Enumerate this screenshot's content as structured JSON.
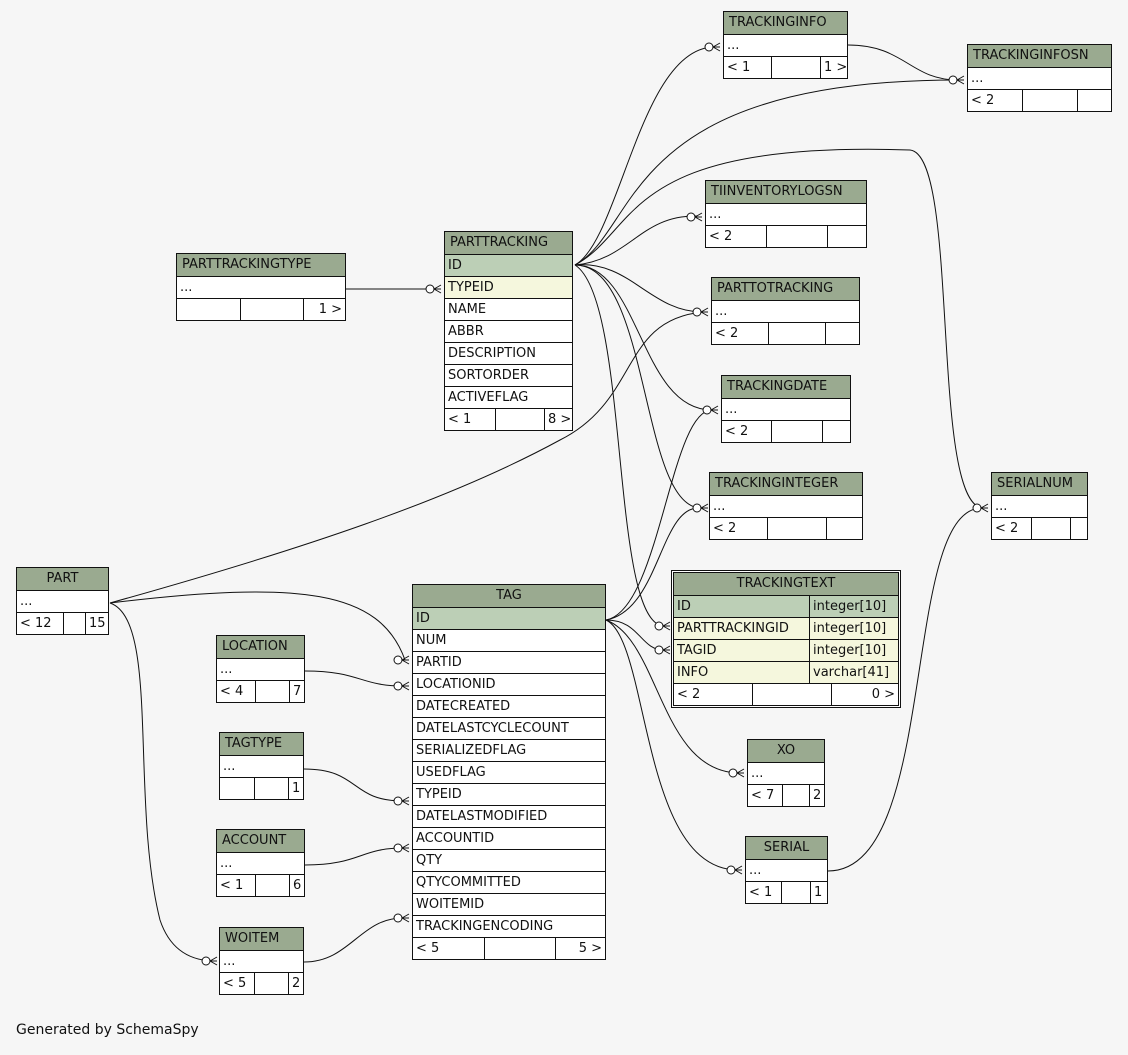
{
  "footer": "Generated by SchemaSpy",
  "tables": {
    "trackinginfo": {
      "name": "TRACKINGINFO",
      "rows": [
        "..."
      ],
      "footer": [
        "< 1",
        "",
        "1 >"
      ]
    },
    "trackinginfosn": {
      "name": "TRACKINGINFOSN",
      "rows": [
        "..."
      ],
      "footer": [
        "< 2",
        "",
        ""
      ]
    },
    "tiinventorylogsn": {
      "name": "TIINVENTORYLOGSN",
      "rows": [
        "..."
      ],
      "footer": [
        "< 2",
        "",
        ""
      ]
    },
    "parttotracking": {
      "name": "PARTTOTRACKING",
      "rows": [
        "..."
      ],
      "footer": [
        "< 2",
        "",
        ""
      ]
    },
    "trackingdate": {
      "name": "TRACKINGDATE",
      "rows": [
        "..."
      ],
      "footer": [
        "< 2",
        "",
        ""
      ]
    },
    "trackinginteger": {
      "name": "TRACKINGINTEGER",
      "rows": [
        "..."
      ],
      "footer": [
        "< 2",
        "",
        ""
      ]
    },
    "serialnum": {
      "name": "SERIALNUM",
      "rows": [
        "..."
      ],
      "footer": [
        "< 2",
        "",
        ""
      ]
    },
    "parttrackingtype": {
      "name": "PARTTRACKINGTYPE",
      "rows": [
        "..."
      ],
      "footer": [
        "",
        "",
        "1 >"
      ]
    },
    "parttracking": {
      "name": "PARTTRACKING",
      "rows": [
        "ID",
        "TYPEID",
        "NAME",
        "ABBR",
        "DESCRIPTION",
        "SORTORDER",
        "ACTIVEFLAG"
      ],
      "footer": [
        "< 1",
        "",
        "8 >"
      ]
    },
    "part": {
      "name": "PART",
      "rows": [
        "..."
      ],
      "footer": [
        "< 12",
        "",
        "15 >"
      ]
    },
    "tag": {
      "name": "TAG",
      "rows": [
        "ID",
        "NUM",
        "PARTID",
        "LOCATIONID",
        "DATECREATED",
        "DATELASTCYCLECOUNT",
        "SERIALIZEDFLAG",
        "USEDFLAG",
        "TYPEID",
        "DATELASTMODIFIED",
        "ACCOUNTID",
        "QTY",
        "QTYCOMMITTED",
        "WOITEMID",
        "TRACKINGENCODING"
      ],
      "footer": [
        "< 5",
        "",
        "5 >"
      ]
    },
    "trackingtext": {
      "name": "TRACKINGTEXT",
      "rows": [
        [
          "ID",
          "integer[10]"
        ],
        [
          "PARTTRACKINGID",
          "integer[10]"
        ],
        [
          "TAGID",
          "integer[10]"
        ],
        [
          "INFO",
          "varchar[41]"
        ]
      ],
      "footer": [
        "< 2",
        "",
        "0 >"
      ]
    },
    "location": {
      "name": "LOCATION",
      "rows": [
        "..."
      ],
      "footer": [
        "< 4",
        "",
        "7 >"
      ]
    },
    "tagtype": {
      "name": "TAGTYPE",
      "rows": [
        "..."
      ],
      "footer": [
        "",
        "",
        "1 >"
      ]
    },
    "account": {
      "name": "ACCOUNT",
      "rows": [
        "..."
      ],
      "footer": [
        "< 1",
        "",
        "6 >"
      ]
    },
    "woitem": {
      "name": "WOITEM",
      "rows": [
        "..."
      ],
      "footer": [
        "< 5",
        "",
        "2 >"
      ]
    },
    "xo": {
      "name": "XO",
      "rows": [
        "..."
      ],
      "footer": [
        "< 7",
        "",
        "2 >"
      ]
    },
    "serial": {
      "name": "SERIAL",
      "rows": [
        "..."
      ],
      "footer": [
        "< 1",
        "",
        "1 >"
      ]
    }
  },
  "colors": {
    "header": "#9aaa90",
    "primary_key": "#bccfb6",
    "foreign_key": "#f5f7dd",
    "background": "#f6f6f6",
    "line": "#111111"
  }
}
